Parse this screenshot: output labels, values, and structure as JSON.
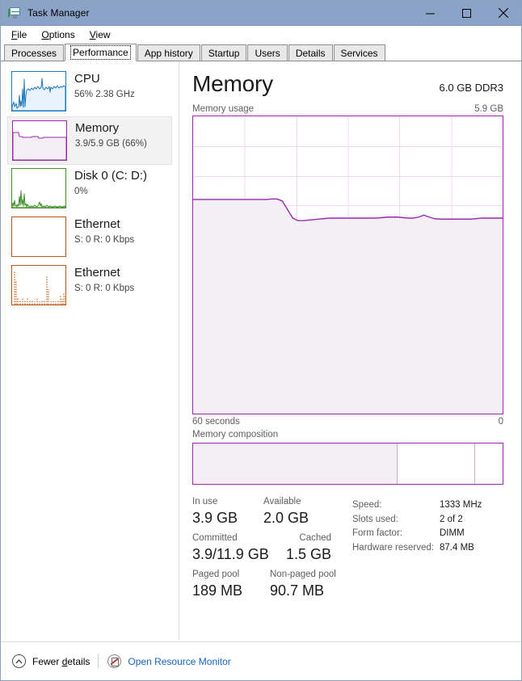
{
  "window": {
    "title": "Task Manager",
    "icon": "task-manager-icon",
    "controls": {
      "minimize": "minimize-icon",
      "maximize": "maximize-icon",
      "close": "close-icon"
    }
  },
  "menubar": {
    "items": [
      {
        "label": "File",
        "accel": "F"
      },
      {
        "label": "Options",
        "accel": "O"
      },
      {
        "label": "View",
        "accel": "V"
      }
    ]
  },
  "tabs": {
    "active": "Performance",
    "items": [
      {
        "label": "Processes"
      },
      {
        "label": "Performance"
      },
      {
        "label": "App history"
      },
      {
        "label": "Startup"
      },
      {
        "label": "Users"
      },
      {
        "label": "Details"
      },
      {
        "label": "Services"
      }
    ]
  },
  "sidebar": {
    "items": [
      {
        "id": "cpu",
        "title": "CPU",
        "sub": "56%  2.38 GHz",
        "color": "#1d76bd",
        "fill": "#e7f2fa",
        "selected": false
      },
      {
        "id": "memory",
        "title": "Memory",
        "sub": "3.9/5.9 GB (66%)",
        "color": "#9b27b0",
        "fill": "#f4eef5",
        "selected": true
      },
      {
        "id": "disk0",
        "title": "Disk 0 (C: D:)",
        "sub": "0%",
        "color": "#3f8f29",
        "fill": "#eef7ea",
        "selected": false
      },
      {
        "id": "ethernet1",
        "title": "Ethernet",
        "sub_prefix_s": "S:",
        "sub_s": "0",
        "sub_prefix_r": "R:",
        "sub_r": "0 Kbps",
        "sub": "S: 0 R: 0 Kbps",
        "color": "#b5561c",
        "fill": "#ffffff",
        "selected": false
      },
      {
        "id": "ethernet2",
        "title": "Ethernet",
        "sub": "S: 0 R: 0 Kbps",
        "color": "#b5561c",
        "fill": "#ffffff",
        "selected": false
      }
    ]
  },
  "main": {
    "title": "Memory",
    "hardware": "6.0 GB DDR3",
    "graph_caption": "Memory usage",
    "graph_max": "5.9 GB",
    "axis_left": "60 seconds",
    "axis_right": "0",
    "composition_label": "Memory composition",
    "accent_color": "#9b27b0",
    "stats": {
      "in_use_label": "In use",
      "in_use_value": "3.9 GB",
      "available_label": "Available",
      "available_value": "2.0 GB",
      "committed_label": "Committed",
      "committed_value": "3.9/11.9 GB",
      "cached_label": "Cached",
      "cached_value": "1.5 GB",
      "paged_label": "Paged pool",
      "paged_value": "189 MB",
      "nonpaged_label": "Non-paged pool",
      "nonpaged_value": "90.7 MB"
    },
    "details": [
      {
        "key": "Speed:",
        "value": "1333 MHz"
      },
      {
        "key": "Slots used:",
        "value": "2 of 2"
      },
      {
        "key": "Form factor:",
        "value": "DIMM"
      },
      {
        "key": "Hardware reserved:",
        "value": "87.4 MB"
      }
    ]
  },
  "chart_data": {
    "type": "area",
    "title": "Memory usage",
    "xlabel": "60 seconds",
    "ylabel": "Memory",
    "ylim": [
      0,
      5.9
    ],
    "xlim": [
      60,
      0
    ],
    "grid": true,
    "grid_cols": 6,
    "grid_rows": 10,
    "unit": "GB",
    "series": [
      {
        "name": "Memory in use",
        "values": [
          4.25,
          4.25,
          4.25,
          4.25,
          4.25,
          4.25,
          4.25,
          4.25,
          4.25,
          4.25,
          4.25,
          4.25,
          4.25,
          4.25,
          4.25,
          4.26,
          4.26,
          4.22,
          4.05,
          3.88,
          3.83,
          3.83,
          3.84,
          3.85,
          3.86,
          3.87,
          3.88,
          3.88,
          3.88,
          3.88,
          3.88,
          3.88,
          3.88,
          3.88,
          3.88,
          3.88,
          3.89,
          3.9,
          3.9,
          3.9,
          3.89,
          3.88,
          3.88,
          3.9,
          3.94,
          3.9,
          3.87,
          3.86,
          3.86,
          3.86,
          3.86,
          3.86,
          3.86,
          3.86,
          3.87,
          3.88,
          3.88,
          3.88,
          3.88,
          3.88
        ]
      }
    ]
  },
  "composition": {
    "segments": [
      {
        "name": "in-use",
        "percent": 66,
        "fill": "#f4eef5"
      },
      {
        "name": "modified-standby",
        "percent": 25,
        "fill": "#ffffff"
      },
      {
        "name": "free",
        "percent": 9,
        "fill": "#ffffff"
      }
    ]
  },
  "footer": {
    "fewer_details": "Fewer details",
    "fewer_accel": "d",
    "open_resource_monitor": "Open Resource Monitor",
    "chevron": "chevron-up-icon",
    "rm_icon": "resource-monitor-icon"
  }
}
